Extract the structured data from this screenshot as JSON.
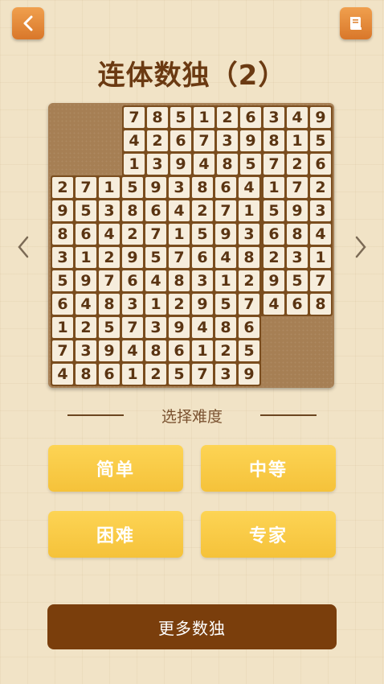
{
  "header": {
    "title": "连体数独（2）",
    "back_icon": "chevron-left-icon",
    "book_icon": "book-icon",
    "accent": "#e08a3a"
  },
  "board": {
    "top_right": [
      [
        "7",
        "8",
        "5",
        "1",
        "2",
        "6",
        "3",
        "4",
        "9"
      ],
      [
        "4",
        "2",
        "6",
        "7",
        "3",
        "9",
        "8",
        "1",
        "5"
      ],
      [
        "1",
        "3",
        "9",
        "4",
        "8",
        "5",
        "7",
        "2",
        "6"
      ],
      [
        "5",
        "9",
        "3",
        "8",
        "6",
        "4",
        "1",
        "7",
        "2"
      ],
      [
        "8",
        "6",
        "4",
        "2",
        "7",
        "1",
        "5",
        "9",
        "3"
      ],
      [
        "2",
        "7",
        "1",
        "5",
        "9",
        "3",
        "6",
        "8",
        "4"
      ],
      [
        "9",
        "5",
        "7",
        "6",
        "4",
        "8",
        "2",
        "3",
        "1"
      ],
      [
        "6",
        "4",
        "8",
        "3",
        "1",
        "2",
        "9",
        "5",
        "7"
      ],
      [
        "3",
        "1",
        "2",
        "9",
        "5",
        "7",
        "4",
        "6",
        "8"
      ]
    ],
    "bottom_left": [
      [
        "2",
        "7",
        "1",
        "5",
        "9",
        "3",
        "8",
        "6",
        "4"
      ],
      [
        "9",
        "5",
        "3",
        "8",
        "6",
        "4",
        "2",
        "7",
        "1"
      ],
      [
        "8",
        "6",
        "4",
        "2",
        "7",
        "1",
        "5",
        "9",
        "3"
      ],
      [
        "3",
        "1",
        "2",
        "9",
        "5",
        "7",
        "6",
        "4",
        "8"
      ],
      [
        "5",
        "9",
        "7",
        "6",
        "4",
        "8",
        "3",
        "1",
        "2"
      ],
      [
        "6",
        "4",
        "8",
        "3",
        "1",
        "2",
        "9",
        "5",
        "7"
      ],
      [
        "1",
        "2",
        "5",
        "7",
        "3",
        "9",
        "4",
        "8",
        "6"
      ],
      [
        "7",
        "3",
        "9",
        "4",
        "8",
        "6",
        "1",
        "2",
        "5"
      ],
      [
        "4",
        "8",
        "6",
        "1",
        "2",
        "5",
        "7",
        "3",
        "9"
      ]
    ]
  },
  "difficulty": {
    "label": "选择难度",
    "easy": "简单",
    "medium": "中等",
    "hard": "困难",
    "expert": "专家"
  },
  "more_button": "更多数独"
}
